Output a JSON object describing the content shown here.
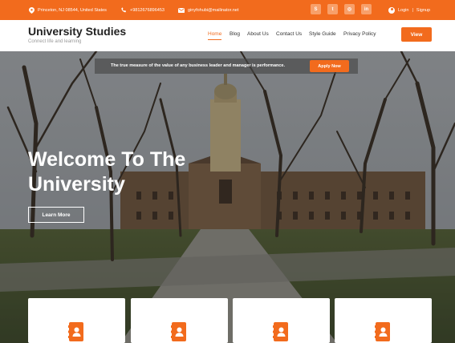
{
  "topbar": {
    "address": "Princeton, NJ 08544, United States",
    "phone": "+9812676896453",
    "email": "ginyfohubi@mailinator.net",
    "social": [
      {
        "name": "skype-icon",
        "glyph": "S"
      },
      {
        "name": "twitter-icon",
        "glyph": "t"
      },
      {
        "name": "instagram-icon",
        "glyph": "◎"
      },
      {
        "name": "linkedin-icon",
        "glyph": "in"
      }
    ],
    "login_label": "Login",
    "separator": "|",
    "signup_label": "Signup"
  },
  "header": {
    "site_title": "University Studies",
    "tagline": "Connect life and learning",
    "nav": [
      "Home",
      "Blog",
      "About Us",
      "Contact Us",
      "Style Guide",
      "Privacy Policy"
    ],
    "active_nav": "Home",
    "view_button": "View"
  },
  "hero": {
    "announcement": "The true measure of the value of any business leader and manager is performance.",
    "apply_button": "Apply Now",
    "title_line1": "Welcome To The",
    "title_line2": "University",
    "learn_more_button": "Learn More"
  },
  "cards": [
    {
      "icon": "address-book-icon"
    },
    {
      "icon": "address-book-icon"
    },
    {
      "icon": "address-book-icon"
    },
    {
      "icon": "address-book-icon"
    }
  ],
  "colors": {
    "accent": "#f26b1d",
    "topbar_bg": "#f26b1d",
    "title_text": "#222222",
    "tagline_text": "#9a9a9a"
  }
}
